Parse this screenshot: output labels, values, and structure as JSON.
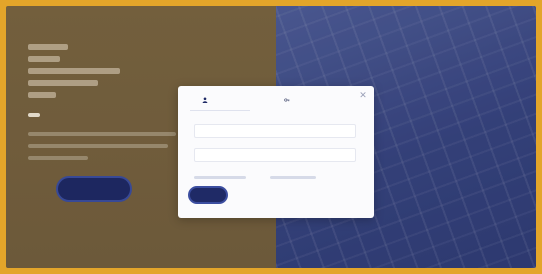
{
  "colors": {
    "page_border": "#e3a52a",
    "left_panel": "#7b6541",
    "right_panel": "#3d4a86",
    "accent_button": "#1f2a66",
    "dialog_bg": "#fbfbfd"
  },
  "topnav": {
    "items": [
      "",
      ""
    ]
  },
  "hero": {
    "badge": ""
  },
  "cta": {
    "label": ""
  },
  "dialog": {
    "tabs": [
      {
        "label": "",
        "icon": "user-icon",
        "active": true
      },
      {
        "label": "",
        "icon": "key-icon",
        "active": false
      }
    ],
    "username": {
      "placeholder": "",
      "value": ""
    },
    "password": {
      "placeholder": "",
      "value": ""
    },
    "links": [
      "",
      ""
    ],
    "submit_label": "",
    "close_icon": "close-icon"
  }
}
